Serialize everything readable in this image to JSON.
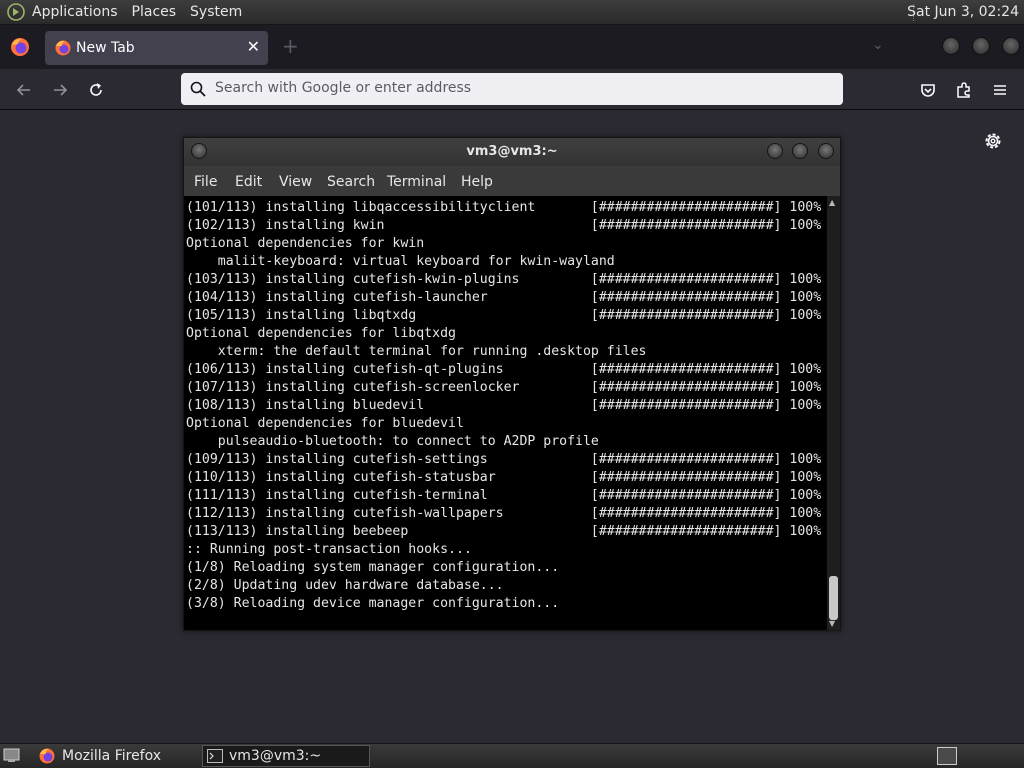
{
  "top_panel": {
    "menus": [
      "Applications",
      "Places",
      "System"
    ],
    "clock": "Sat Jun  3, 02:24"
  },
  "browser": {
    "tab": {
      "title": "New Tab",
      "close_glyph": "✕"
    },
    "new_tab_glyph": "+",
    "list_all_glyph": "⌄",
    "urlbar": {
      "placeholder": "Search with Google or enter address"
    }
  },
  "terminal": {
    "title": "vm3@vm3:~",
    "menus": [
      "File",
      "Edit",
      "View",
      "Search",
      "Terminal",
      "Help"
    ],
    "lines": [
      "(101/113) installing libqaccessibilityclient       [######################] 100%",
      "(102/113) installing kwin                          [######################] 100%",
      "Optional dependencies for kwin",
      "    maliit-keyboard: virtual keyboard for kwin-wayland",
      "(103/113) installing cutefish-kwin-plugins         [######################] 100%",
      "(104/113) installing cutefish-launcher             [######################] 100%",
      "(105/113) installing libqtxdg                      [######################] 100%",
      "Optional dependencies for libqtxdg",
      "    xterm: the default terminal for running .desktop files",
      "(106/113) installing cutefish-qt-plugins           [######################] 100%",
      "(107/113) installing cutefish-screenlocker         [######################] 100%",
      "(108/113) installing bluedevil                     [######################] 100%",
      "Optional dependencies for bluedevil",
      "    pulseaudio-bluetooth: to connect to A2DP profile",
      "(109/113) installing cutefish-settings             [######################] 100%",
      "(110/113) installing cutefish-statusbar            [######################] 100%",
      "(111/113) installing cutefish-terminal             [######################] 100%",
      "(112/113) installing cutefish-wallpapers           [######################] 100%",
      "(113/113) installing beebeep                       [######################] 100%",
      ":: Running post-transaction hooks...",
      "(1/8) Reloading system manager configuration...",
      "(2/8) Updating udev hardware database...",
      "(3/8) Reloading device manager configuration..."
    ]
  },
  "taskbar": {
    "tasks": [
      {
        "label": "Mozilla Firefox",
        "icon": "firefox-icon"
      },
      {
        "label": "vm3@vm3:~",
        "icon": "terminal-icon"
      }
    ]
  },
  "colors": {
    "browser_bg": "#2b2a33",
    "tabbar_bg": "#1c1b22",
    "terminal_bg": "#000000",
    "panel_bg": "#2a2a2a"
  }
}
